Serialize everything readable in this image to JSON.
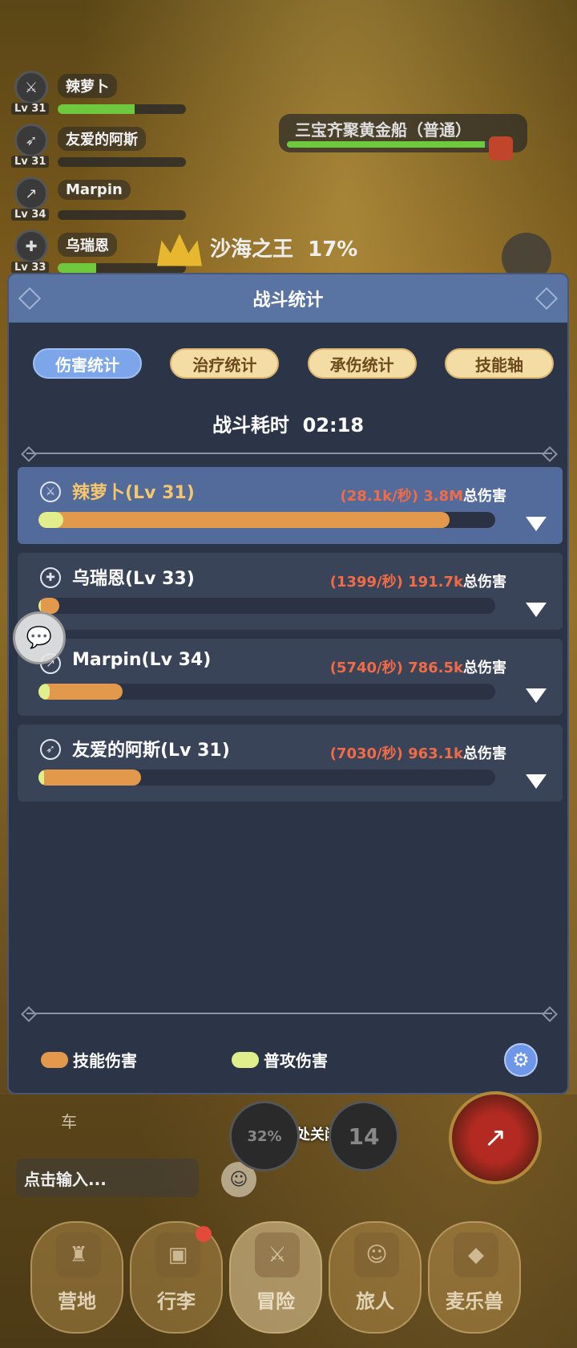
{
  "party": [
    {
      "name": "辣萝卜",
      "level": "Lv 31",
      "hp": 0.6,
      "icon": "crossed-swords-icon"
    },
    {
      "name": "友爱的阿斯",
      "level": "Lv 31",
      "hp": 0.0,
      "icon": "spiral-bow-icon"
    },
    {
      "name": "Marpin",
      "level": "Lv 34",
      "hp": 0.0,
      "icon": "dagger-icon"
    },
    {
      "name": "乌瑞恩",
      "level": "Lv 33",
      "hp": 0.3,
      "icon": "shield-cross-icon"
    }
  ],
  "boss_top": {
    "name": "三宝齐聚黄金船（普通）",
    "hp": 0.95
  },
  "boss_main": {
    "name": "沙海之王",
    "percent": "17%"
  },
  "modal": {
    "title": "战斗统计",
    "tabs": [
      "伤害统计",
      "治疗统计",
      "承伤统计",
      "技能轴"
    ],
    "active_tab": 0,
    "duration_label": "战斗耗时",
    "duration": "02:18",
    "rows": [
      {
        "name": "辣萝卜(Lv 31)",
        "dps": "(28.1k/秒) 3.8M",
        "suffix": "总伤害",
        "skill": 0.9,
        "basic": 0.055,
        "me": true,
        "icon": "crossed-swords-icon"
      },
      {
        "name": "乌瑞恩(Lv 33)",
        "dps": "(1399/秒) 191.7k",
        "suffix": "总伤害",
        "skill": 0.045,
        "basic": 0.004,
        "me": false,
        "icon": "shield-cross-icon"
      },
      {
        "name": "Marpin(Lv 34)",
        "dps": "(5740/秒) 786.5k",
        "suffix": "总伤害",
        "skill": 0.185,
        "basic": 0.025,
        "me": false,
        "icon": "dagger-icon"
      },
      {
        "name": "友爱的阿斯(Lv 31)",
        "dps": "(7030/秒) 963.1k",
        "suffix": "总伤害",
        "skill": 0.225,
        "basic": 0.012,
        "me": false,
        "icon": "spiral-bow-icon"
      }
    ],
    "legend": {
      "skill": "技能伤害",
      "basic": "普攻伤害",
      "skill_color": "#e3994c",
      "basic_color": "#e0ef8b"
    }
  },
  "bottom": {
    "close_hint": "点击空白处关闭",
    "chat_text": "车",
    "input_placeholder": "点击输入...",
    "skill_cooldown": "14",
    "skill_cooldown_pct": "32%"
  },
  "nav": [
    {
      "label": "营地",
      "icon": "castle-icon"
    },
    {
      "label": "行李",
      "icon": "backpack-icon",
      "badge": true
    },
    {
      "label": "冒险",
      "icon": "crossed-swords-icon",
      "active": true
    },
    {
      "label": "旅人",
      "icon": "person-icon"
    },
    {
      "label": "麦乐兽",
      "icon": "fox-icon"
    }
  ]
}
